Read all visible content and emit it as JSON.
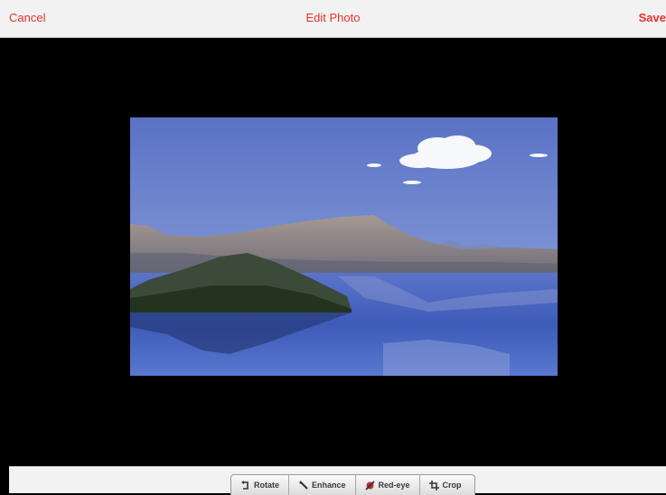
{
  "header": {
    "cancel_label": "Cancel",
    "title": "Edit Photo",
    "save_label": "Save"
  },
  "photo": {
    "subject": "lake with island and cliffs under blue sky"
  },
  "toolbar": {
    "rotate_label": "Rotate",
    "enhance_label": "Enhance",
    "redeye_label": "Red-eye",
    "crop_label": "Crop"
  },
  "colors": {
    "accent": "#e8312d",
    "bar_bg": "#f2f2f2",
    "canvas_bg": "#000000"
  },
  "icons": {
    "rotate": "rotate-icon",
    "enhance": "magic-wand-icon",
    "redeye": "red-eye-icon",
    "crop": "crop-icon"
  }
}
